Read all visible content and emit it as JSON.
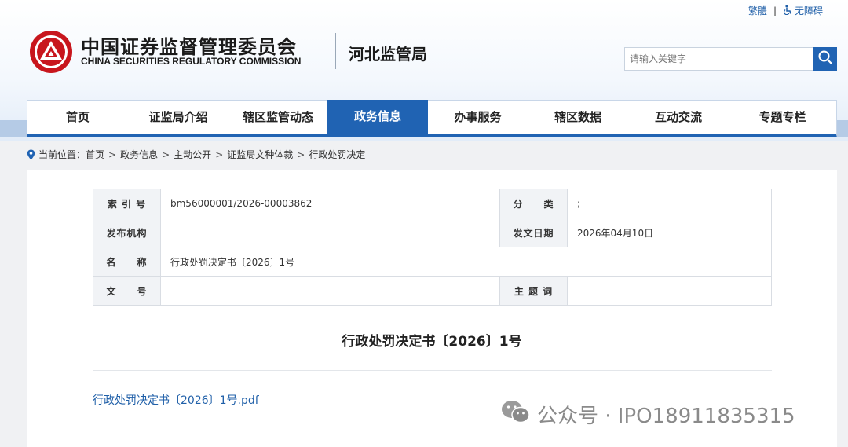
{
  "toplinks": {
    "traditional": "繁體",
    "separator": "|",
    "accessibility": "无障碍"
  },
  "logo": {
    "cn": "中国证券监督管理委员会",
    "en": "CHINA SECURITIES REGULATORY COMMISSION"
  },
  "bureau": "河北监管局",
  "search": {
    "placeholder": "请输入关键字"
  },
  "nav": [
    "首页",
    "证监局介绍",
    "辖区监管动态",
    "政务信息",
    "办事服务",
    "辖区数据",
    "互动交流",
    "专题专栏"
  ],
  "nav_active": "政务信息",
  "breadcrumb": {
    "prefix": "当前位置：",
    "items": [
      "首页",
      "政务信息",
      "主动公开",
      "证监局文种体裁",
      "行政处罚决定"
    ],
    "sep": ">"
  },
  "meta": {
    "index_label": "索 引 号",
    "index_value": "bm56000001/2026-00003862",
    "category_label": "分　　类",
    "category_value": ";",
    "publisher_label": "发布机构",
    "publisher_value": "",
    "date_label": "发文日期",
    "date_value": "2026年04月10日",
    "name_label": "名　　称",
    "name_value": "行政处罚决定书〔2026〕1号",
    "docno_label": "文　　号",
    "docno_value": "",
    "keyword_label": "主 题 词",
    "keyword_value": ""
  },
  "doc_title": "行政处罚决定书〔2026〕1号",
  "attachment": "行政处罚决定书〔2026〕1号.pdf",
  "watermark": "公众号 · IPO18911835315",
  "colors": {
    "primary": "#2063b3",
    "logo_red": "#c8161d",
    "link": "#1f5fa8"
  }
}
